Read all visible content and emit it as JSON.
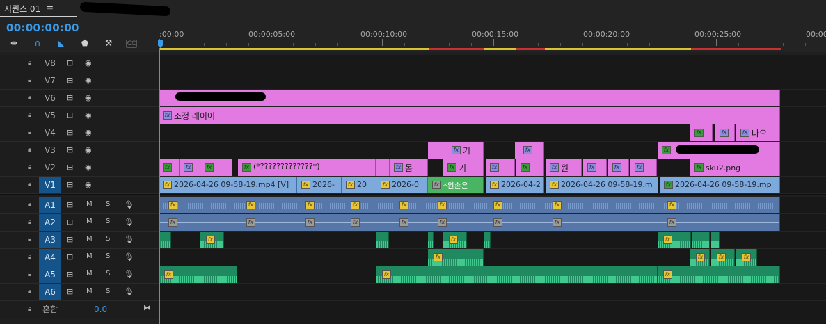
{
  "sequence": {
    "tab_title": "시퀀스 01",
    "menu_icon": "≡",
    "timecode": "00:00:00:00"
  },
  "tools": [
    "snap-icon",
    "magnet-icon",
    "linked-selection-icon",
    "marker-icon",
    "wrench-icon",
    "captions-icon"
  ],
  "ruler": {
    "labels": [
      ":00:00",
      "00:00:05:00",
      "00:00:10:00",
      "00:00:15:00",
      "00:00:20:00",
      "00:00:25:00",
      "00:00"
    ]
  },
  "video_tracks": [
    "V8",
    "V7",
    "V6",
    "V5",
    "V4",
    "V3",
    "V2",
    "V1"
  ],
  "audio_tracks": [
    "A1",
    "A2",
    "A3",
    "A4",
    "A5",
    "A6"
  ],
  "audio_buttons": {
    "mute": "M",
    "solo": "S"
  },
  "mix": {
    "label": "혼합",
    "value": "0.0"
  },
  "clips": {
    "v5_adjust": "조정 레이어",
    "v4_text": "나오",
    "v3_a": "기",
    "v2_q": "(*?????????????*)",
    "v2_body": "몸",
    "v2_gi": "기",
    "v2_won": "원",
    "v2_sku": "sku2.png",
    "v1_a": "2026-04-26 09-58-19.mp4 [V]",
    "v1_b": "2026-",
    "v1_c": "20",
    "v1_d": "2026-0",
    "v1_e": "*왼손은",
    "v1_f": "2026-04-2",
    "v1_g": "2026-04-26 09-58-19.m",
    "v1_h": "2026-04-26 09-58-19.mp"
  },
  "colors": {
    "accent": "#3a9be8",
    "video_clip": "#e27ae2",
    "v1_clip": "#7da9dd",
    "audio_clip": "#5777a8",
    "music_clip": "#1f8a5f"
  }
}
